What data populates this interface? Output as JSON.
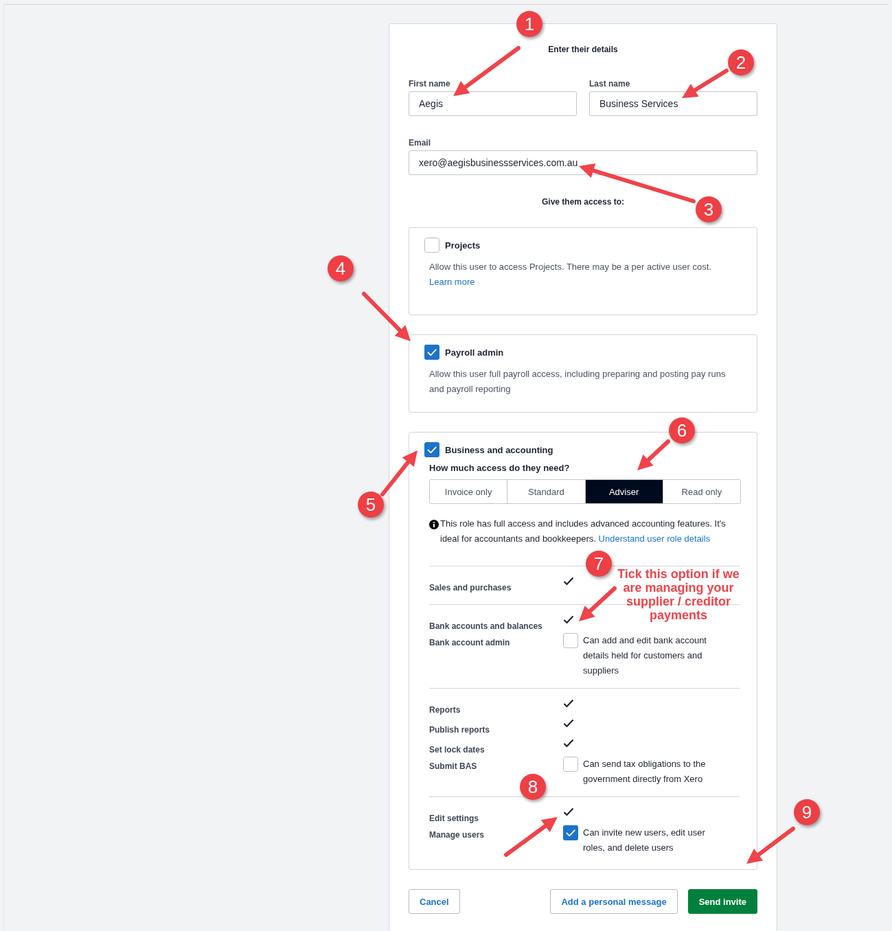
{
  "form": {
    "heading": "Enter their details",
    "fields": [
      {
        "label": "First name",
        "value": "Aegis"
      },
      {
        "label": "Last name",
        "value": "Business Services"
      },
      {
        "label": "Email",
        "value": "xero@aegisbusinessservices.com.au"
      }
    ],
    "access_heading": "Give them access to:",
    "options": [
      {
        "title": "Projects",
        "checked": false,
        "description": "Allow this user to access Projects. There may be a per active user cost.",
        "link": "Learn more"
      },
      {
        "title": "Payroll admin",
        "checked": true,
        "description": "Allow this user full payroll access, including preparing and posting pay runs and payroll reporting"
      }
    ],
    "business": {
      "title": "Business and accounting",
      "checked": true,
      "question": "How much access do they need?",
      "roles": [
        {
          "label": "Invoice only",
          "selected": false
        },
        {
          "label": "Standard",
          "selected": false
        },
        {
          "label": "Adviser",
          "selected": true
        },
        {
          "label": "Read only",
          "selected": false
        }
      ],
      "info": "This role has full access and includes advanced accounting features. It's ideal for accountants and bookkeepers.",
      "info_link": "Understand user role details",
      "groups": [
        [
          {
            "label": "Sales and purchases",
            "kind": "included"
          }
        ],
        [
          {
            "label": "Bank accounts and balances",
            "kind": "included"
          },
          {
            "label": "Bank account admin",
            "kind": "option",
            "checked": false,
            "description": "Can add and edit bank account details held for customers and suppliers"
          }
        ],
        [
          {
            "label": "Reports",
            "kind": "included"
          },
          {
            "label": "Publish reports",
            "kind": "included"
          },
          {
            "label": "Set lock dates",
            "kind": "included"
          },
          {
            "label": "Submit BAS",
            "kind": "option",
            "checked": false,
            "description": "Can send tax obligations to the government directly from Xero"
          }
        ],
        [
          {
            "label": "Edit settings",
            "kind": "included"
          },
          {
            "label": "Manage users",
            "kind": "option",
            "checked": true,
            "description": "Can invite new users, edit user roles, and delete users"
          }
        ]
      ]
    },
    "buttons": [
      {
        "label": "Cancel",
        "kind": "secondary"
      },
      {
        "label": "Add a personal message",
        "kind": "secondary"
      },
      {
        "label": "Send invite",
        "kind": "primary"
      }
    ]
  },
  "annotations": {
    "markers": [
      {
        "number": "1"
      },
      {
        "number": "2"
      },
      {
        "number": "3"
      },
      {
        "number": "4"
      },
      {
        "number": "5"
      },
      {
        "number": "6"
      },
      {
        "number": "7"
      },
      {
        "number": "8"
      },
      {
        "number": "9"
      }
    ],
    "note": "Tick this option if we are managing your supplier / creditor payments"
  }
}
